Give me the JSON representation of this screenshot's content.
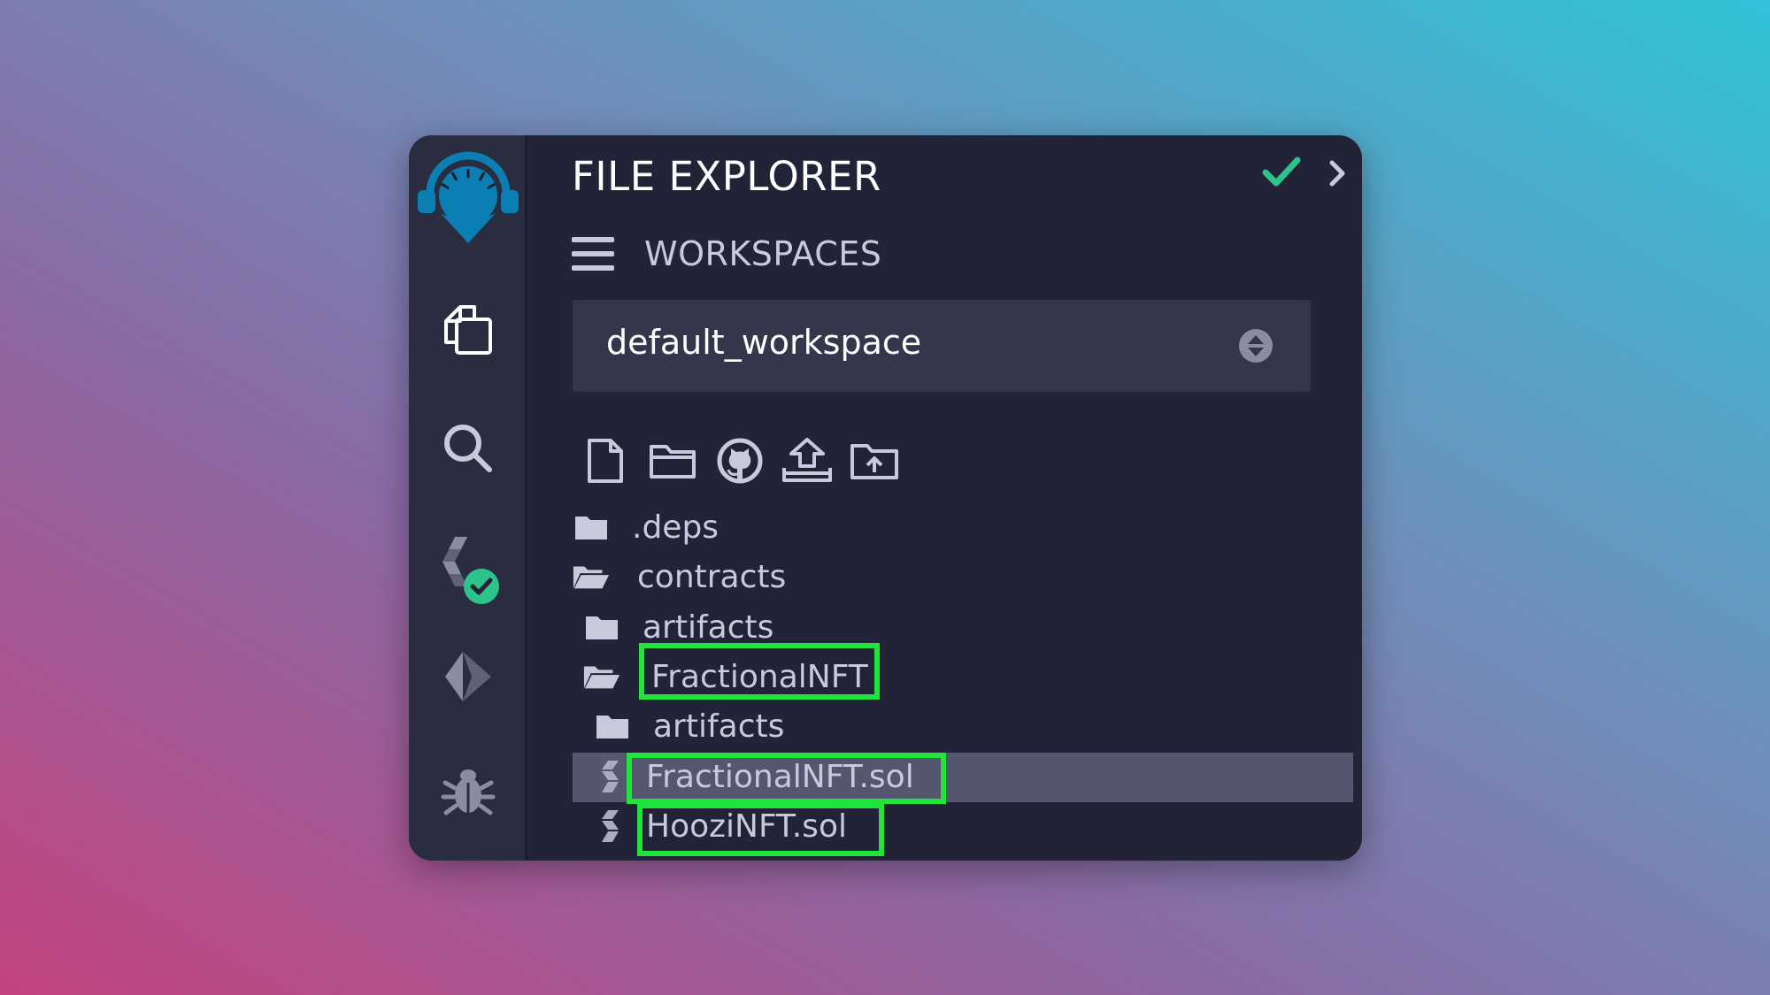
{
  "header": {
    "title": "FILE EXPLORER"
  },
  "workspaces": {
    "label": "WORKSPACES",
    "selected": "default_workspace"
  },
  "sidebar": {
    "icons": [
      "remix-logo-icon",
      "file-explorer-icon",
      "search-icon",
      "solidity-compiler-icon",
      "deploy-run-icon",
      "debugger-icon"
    ]
  },
  "toolbar": {
    "icons": [
      "new-file-icon",
      "new-folder-icon",
      "github-icon",
      "upload-file-icon",
      "upload-folder-icon"
    ]
  },
  "tree": {
    "deps": ".deps",
    "contracts": "contracts",
    "artifacts1": "artifacts",
    "fractional_folder": "FractionalNFT",
    "artifacts2": "artifacts",
    "fractional_sol": "FractionalNFT.sol",
    "hoozi_sol": "HooziNFT.sol"
  },
  "colors": {
    "panel": "#222336",
    "sidebar": "#2a2c3f",
    "select": "#34364b",
    "selected_row": "#555770",
    "highlight": "#1fe43a",
    "check": "#2bc48a",
    "logo": "#0b7fb3"
  }
}
